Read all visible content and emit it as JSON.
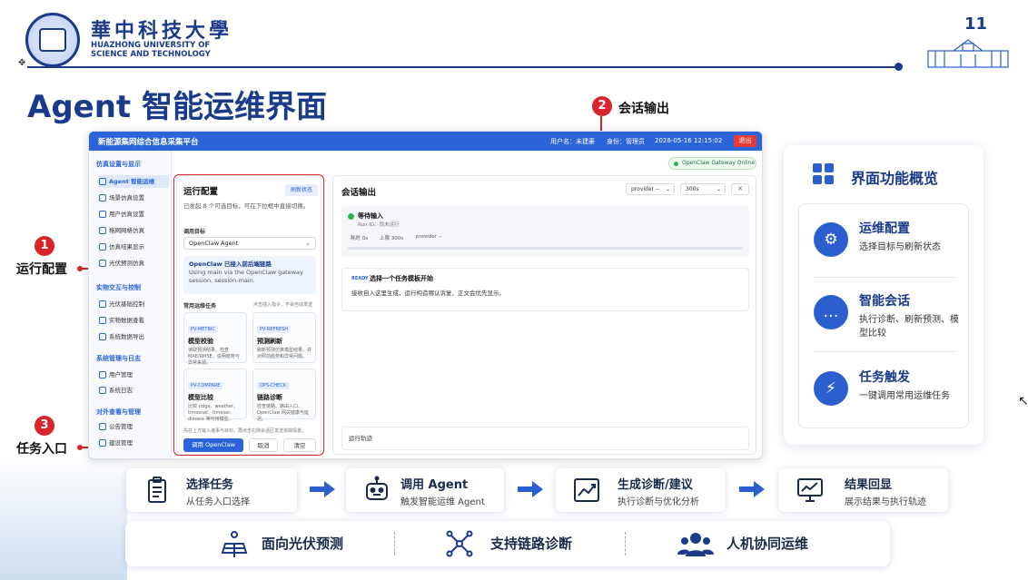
{
  "slide": {
    "university_cn": "華中科技大學",
    "university_en": "HUAZHONG UNIVERSITY OF SCIENCE AND TECHNOLOGY",
    "page_number": "11",
    "title": "Agent 智能运维界面"
  },
  "callouts": [
    {
      "num": "1",
      "label": "运行配置"
    },
    {
      "num": "2",
      "label": "会话输出"
    },
    {
      "num": "3",
      "label": "任务入口"
    }
  ],
  "app": {
    "title": "新能源集网综合信息采集平台",
    "user": "用户名：未建豪",
    "role": "身份：管理员",
    "datetime": "2026-05-16 12:15:02",
    "logout": "退出",
    "gateway_status": "OpenClaw Gateway Online",
    "sidebar": [
      {
        "group": "仿真设置与显示",
        "items": [
          "Agent 智能运维",
          "场景仿真设置",
          "用户仿真设置",
          "格网网格仿真",
          "仿真结果显示",
          "光伏预测仿真"
        ]
      },
      {
        "group": "实物交互与控制",
        "items": [
          "光伏基础控制",
          "实物数据查看",
          "系统数据导出"
        ]
      },
      {
        "group": "系统管理与日志",
        "items": [
          "用户管理",
          "系统日志"
        ]
      },
      {
        "group": "对外查看与管理",
        "items": [
          "公告管理",
          "建设管理"
        ]
      }
    ],
    "run_panel": {
      "title": "运行配置",
      "refresh": "刷新状态",
      "desc": "已发起 8 个可选目标，可在下拉框中直接切换。",
      "target_label": "调用目标",
      "target_value": "OpenClaw Agent",
      "info_title": "OpenClaw 已接入前后端链路",
      "info_desc": "Using main via the OpenClaw gateway session, session-main.",
      "tasks_header": "常用运维任务",
      "tasks_hint": "点击插入指令，不会自动发送",
      "tasks": [
        {
          "tag": "PV-METRIC",
          "name": "模型校验",
          "desc": "读取预测结果，检查 MAE/RMSE，说明趋势与异常来源。"
        },
        {
          "tag": "PV-REFRESH",
          "name": "预测刷新",
          "desc": "刷新预测仿真模型结果，并对照前趋势和异常问题。"
        },
        {
          "tag": "PV-COMPARE",
          "name": "模型比较",
          "desc": "比较 ridge、weather、timesnet、timexer、dlinace 等可用模型。"
        },
        {
          "tag": "OPS-CHECK",
          "name": "链路诊断",
          "desc": "检查链路、路由入口、OpenClaw 网关健康与延迟。"
        }
      ],
      "footer_hint": "先在上方输入诸事与目标，再点击右侧会话区发送追踪情景。",
      "btn_call": "调用 OpenClaw Agent",
      "btn_cancel": "取消",
      "btn_clear": "清空"
    },
    "conv_panel": {
      "title": "会话输出",
      "provider_select": "provider --",
      "timeout_select": "300s",
      "close": "✕",
      "status": "等待输入",
      "run_id": "Run ID：尚未运行",
      "meta": [
        "耗时 0s",
        "上限 300s",
        "provider --"
      ],
      "ready_tag": "READY",
      "msg_title": "选择一个任务模板开始",
      "msg_body": "接收自入这里生成，运行构造哪认诉复，正文会优先显示。",
      "track": "运行轨迹"
    }
  },
  "overview": {
    "title": "界面功能概览",
    "items": [
      {
        "title": "运维配置",
        "desc": "选择目标与刷新状态",
        "icon": "gear-icon"
      },
      {
        "title": "智能会话",
        "desc": "执行诊断、刷新预测、模型比较",
        "icon": "chat-icon"
      },
      {
        "title": "任务触发",
        "desc": "一键调用常用运维任务",
        "icon": "lightning-icon"
      }
    ]
  },
  "flow": [
    {
      "title": "选择任务",
      "desc": "从任务入口选择"
    },
    {
      "title": "调用 Agent",
      "desc": "触发智能运维 Agent"
    },
    {
      "title": "生成诊断/建议",
      "desc": "执行诊断与优化分析"
    },
    {
      "title": "结果回显",
      "desc": "展示结果与执行轨迹"
    }
  ],
  "features": [
    "面向光伏预测",
    "支持链路诊断",
    "人机协同运维"
  ],
  "colors": {
    "primary": "#2b63d9",
    "navy": "#1a3a8a",
    "accent_red": "#d8242a",
    "online_green": "#2bb24c"
  }
}
